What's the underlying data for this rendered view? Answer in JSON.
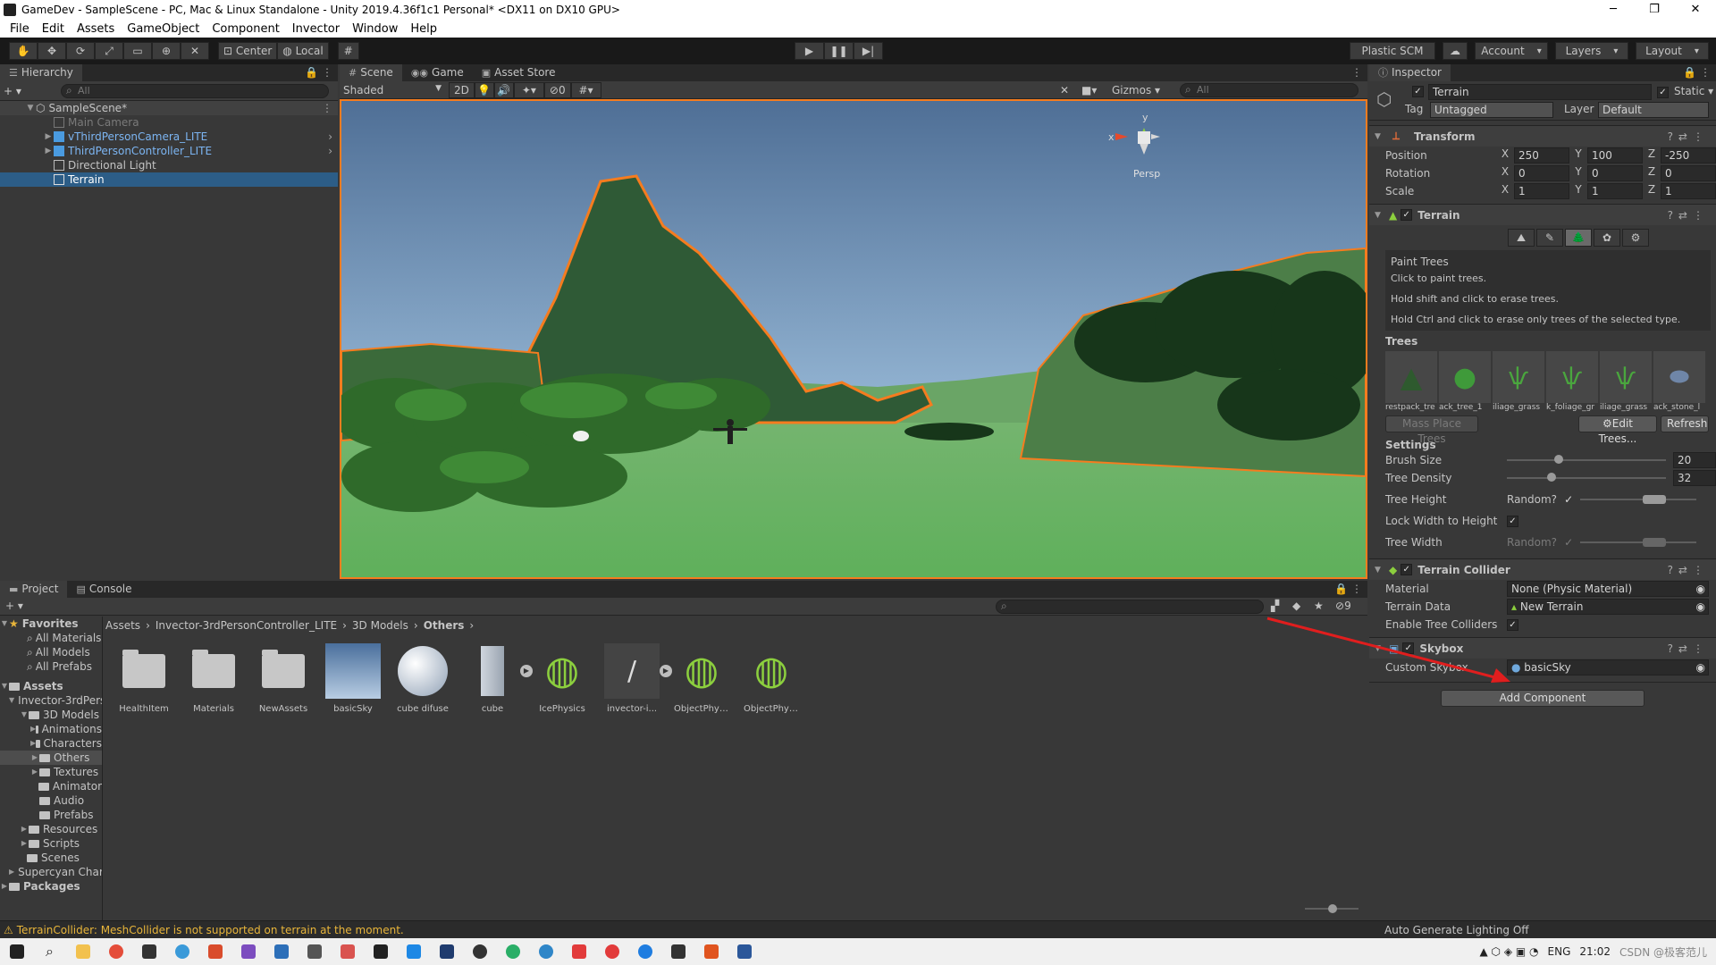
{
  "window": {
    "title": "GameDev - SampleScene - PC, Mac & Linux Standalone - Unity 2019.4.36f1c1 Personal* <DX11 on DX10 GPU>",
    "minimize": "─",
    "maximize": "❐",
    "close": "✕"
  },
  "menu": [
    "File",
    "Edit",
    "Assets",
    "GameObject",
    "Component",
    "Invector",
    "Window",
    "Help"
  ],
  "toolbar": {
    "pivot": "Center",
    "space": "Local",
    "plastic": "Plastic SCM",
    "account": "Account",
    "layers": "Layers",
    "layout": "Layout"
  },
  "hierarchy": {
    "tab": "Hierarchy",
    "search_placeholder": "All",
    "scene": "SampleScene*",
    "items": [
      {
        "label": "Main Camera",
        "state": "disabled"
      },
      {
        "label": "vThirdPersonCamera_LITE",
        "state": "prefab"
      },
      {
        "label": "ThirdPersonController_LITE",
        "state": "prefab"
      },
      {
        "label": "Directional Light",
        "state": "normal"
      },
      {
        "label": "Terrain",
        "state": "selected"
      }
    ]
  },
  "scene": {
    "tabs": [
      "Scene",
      "Game",
      "Asset Store"
    ],
    "shading": "Shaded",
    "mode_2d": "2D",
    "hidden_count": "0",
    "gizmos": "Gizmos",
    "search_placeholder": "All",
    "persp": "Persp",
    "axis_x": "x",
    "axis_y": "y"
  },
  "inspector": {
    "tab": "Inspector",
    "object_name": "Terrain",
    "static": "Static",
    "tag_label": "Tag",
    "tag": "Untagged",
    "layer_label": "Layer",
    "layer": "Default",
    "transform": {
      "title": "Transform",
      "rows": [
        {
          "label": "Position",
          "x": "250",
          "y": "100",
          "z": "-250"
        },
        {
          "label": "Rotation",
          "x": "0",
          "y": "0",
          "z": "0"
        },
        {
          "label": "Scale",
          "x": "1",
          "y": "1",
          "z": "1"
        }
      ]
    },
    "terrain": {
      "title": "Terrain",
      "help_title": "Paint Trees",
      "help_lines": [
        "Click to paint trees.",
        "Hold shift and click to erase trees.",
        "Hold Ctrl and click to erase only trees of the selected type."
      ],
      "trees_label": "Trees",
      "trees": [
        "restpack_tre",
        "ack_tree_1",
        "iliage_grass",
        "k_foliage_gr",
        "iliage_grass",
        "ack_stone_l"
      ],
      "mass_place": "Mass Place Trees",
      "edit_trees": "Edit Trees...",
      "refresh": "Refresh",
      "settings_label": "Settings",
      "brush_size_label": "Brush Size",
      "brush_size": "20",
      "brush_size_frac": 0.3,
      "tree_density_label": "Tree Density",
      "tree_density": "32",
      "tree_density_frac": 0.25,
      "tree_height_label": "Tree Height",
      "random_label": "Random?",
      "lock_width_label": "Lock Width to Height",
      "tree_width_label": "Tree Width"
    },
    "terrain_collider": {
      "title": "Terrain Collider",
      "material_label": "Material",
      "material": "None (Physic Material)",
      "terrain_data_label": "Terrain Data",
      "terrain_data": "New Terrain",
      "enable_tree_label": "Enable Tree Colliders"
    },
    "skybox": {
      "title": "Skybox",
      "custom_label": "Custom Skybox",
      "custom": "basicSky"
    },
    "add_component": "Add Component"
  },
  "project": {
    "tabs": [
      "Project",
      "Console"
    ],
    "hidden_count": "9",
    "favorites": {
      "label": "Favorites",
      "items": [
        "All Materials",
        "All Models",
        "All Prefabs"
      ]
    },
    "tree": [
      {
        "label": "Assets",
        "depth": 0
      },
      {
        "label": "Invector-3rdPersonController_LITE",
        "depth": 1
      },
      {
        "label": "3D Models",
        "depth": 2
      },
      {
        "label": "Animations",
        "depth": 3
      },
      {
        "label": "Characters",
        "depth": 3
      },
      {
        "label": "Others",
        "depth": 3,
        "selected": true
      },
      {
        "label": "Textures",
        "depth": 3
      },
      {
        "label": "Animator",
        "depth": 2
      },
      {
        "label": "Audio",
        "depth": 2
      },
      {
        "label": "Prefabs",
        "depth": 2
      },
      {
        "label": "Resources",
        "depth": 2
      },
      {
        "label": "Scripts",
        "depth": 2
      },
      {
        "label": "Scenes",
        "depth": 1
      },
      {
        "label": "Supercyan Character Pack",
        "depth": 1
      },
      {
        "label": "Packages",
        "depth": 0
      }
    ],
    "breadcrumb": [
      "Assets",
      "Invector-3rdPersonController_LITE",
      "3D Models",
      "Others"
    ],
    "assets": [
      {
        "name": "HealthItem",
        "kind": "folder"
      },
      {
        "name": "Materials",
        "kind": "folder"
      },
      {
        "name": "NewAssets",
        "kind": "folder"
      },
      {
        "name": "basicSky",
        "kind": "sky"
      },
      {
        "name": "cube difuse",
        "kind": "sphere"
      },
      {
        "name": "cube",
        "kind": "cube"
      },
      {
        "name": "IcePhysics",
        "kind": "physics"
      },
      {
        "name": "invector-i...",
        "kind": "logo"
      },
      {
        "name": "ObjectPhys...",
        "kind": "physics"
      },
      {
        "name": "ObjectPhys...",
        "kind": "physics"
      }
    ]
  },
  "status": {
    "message": "TerrainCollider: MeshCollider is not supported on terrain at the moment.",
    "right": "Auto Generate Lighting Off"
  },
  "taskbar": {
    "lang": "ENG",
    "time": "21:02",
    "watermark": "CSDN @极客范儿"
  }
}
